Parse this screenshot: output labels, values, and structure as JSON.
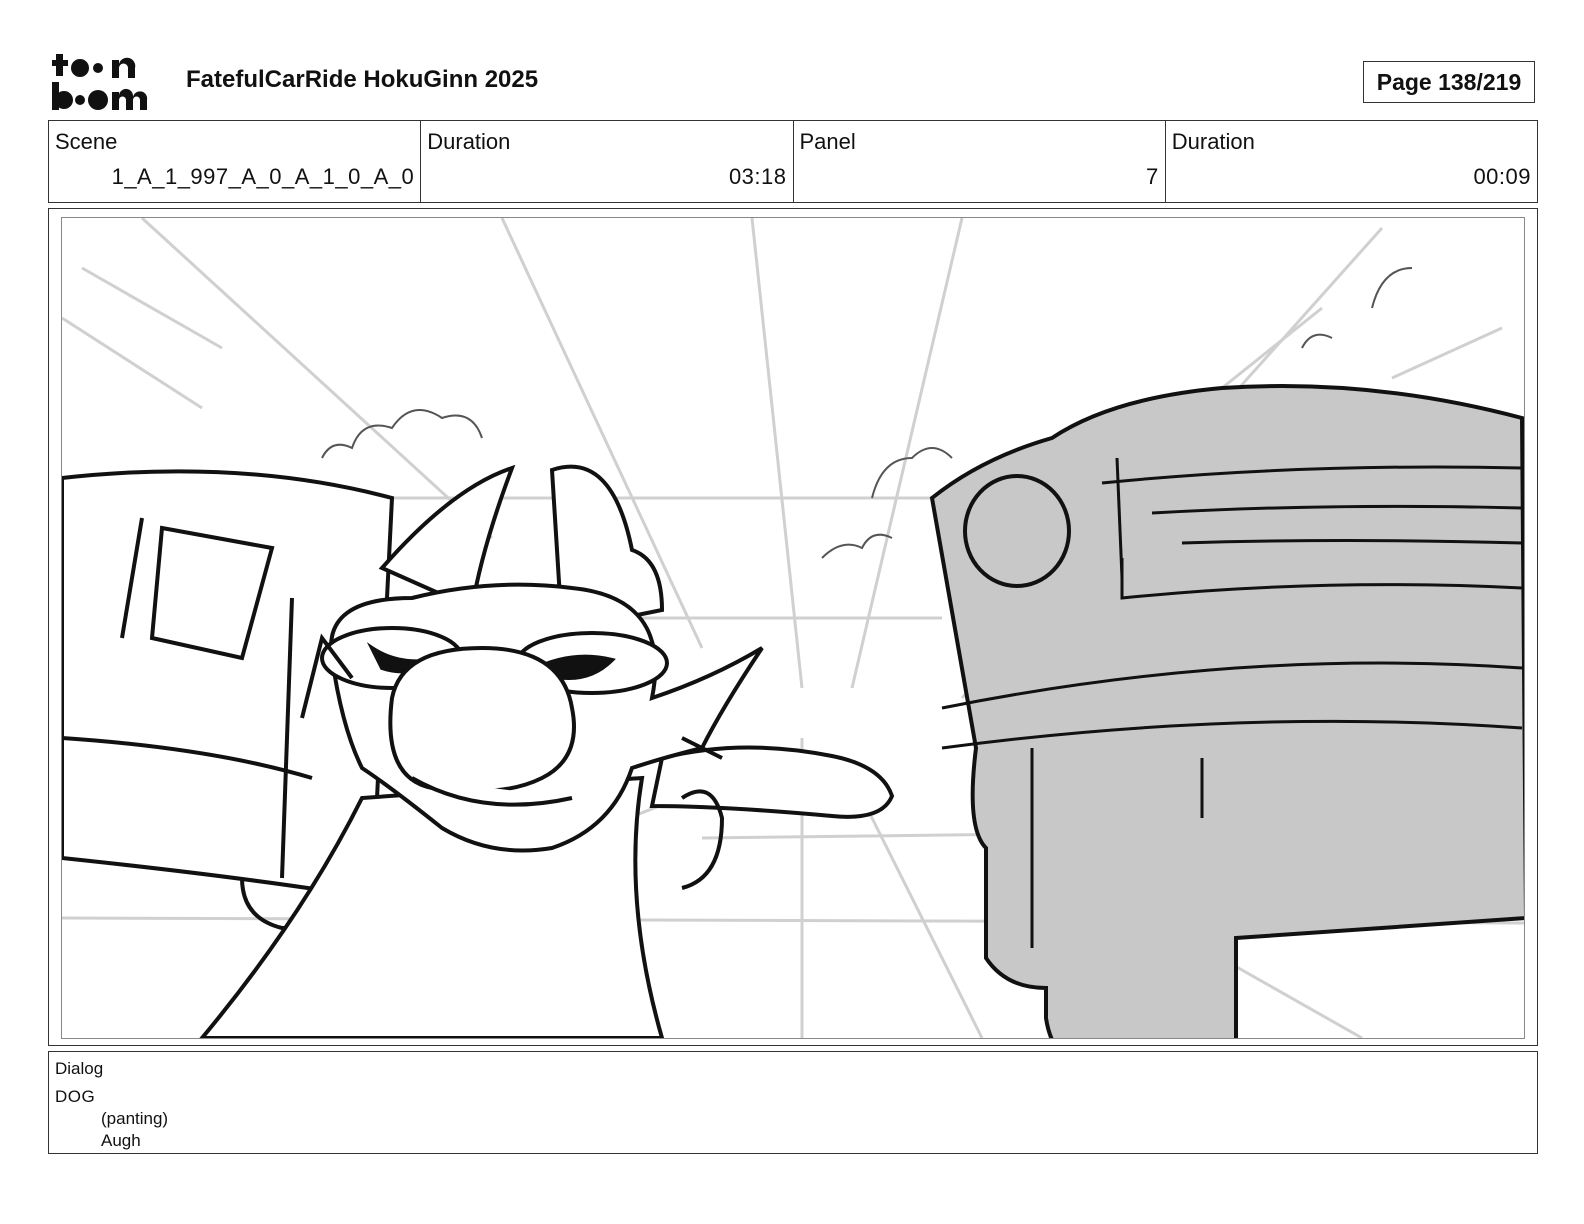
{
  "header": {
    "logo_text": "toonboom",
    "project_title": "FatefulCarRide HokuGinn 2025",
    "page_indicator": "Page 138/219"
  },
  "info": {
    "scene_label": "Scene",
    "scene_value": "1_A_1_997_A_0_A_1_0_A_0",
    "scene_duration_label": "Duration",
    "scene_duration_value": "03:18",
    "panel_label": "Panel",
    "panel_value": "7",
    "panel_duration_label": "Duration",
    "panel_duration_value": "00:09"
  },
  "dialog": {
    "label": "Dialog",
    "speaker": "DOG",
    "parenthetical": "(panting)",
    "line": "Augh"
  },
  "colors": {
    "border": "#333333",
    "car_fill": "#c8c8c8",
    "sketch_line": "#111111",
    "guide_line": "#cfcfcf"
  }
}
